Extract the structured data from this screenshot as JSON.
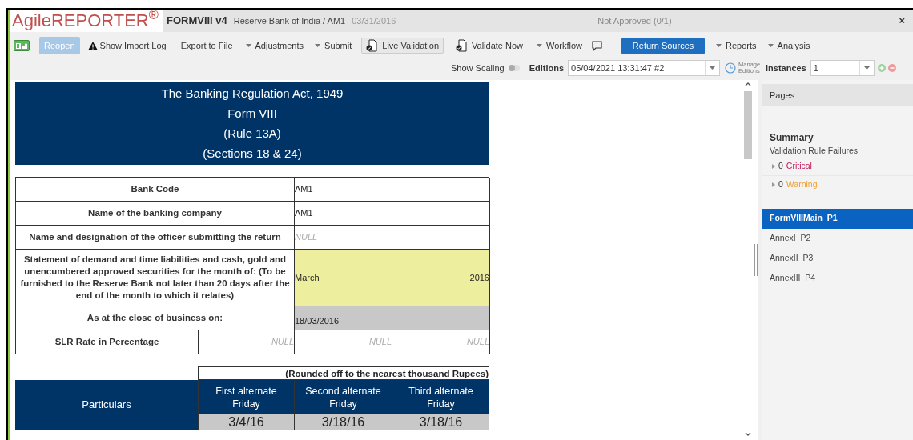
{
  "header": {
    "logo": "AgileREPORTER$^{®}$",
    "form": "FORMVIII v4",
    "entity": "Reserve Bank of India / AM1",
    "date": "03/31/2016",
    "status": "Not Approved (0/1)",
    "close": "×"
  },
  "toolbar": [
    {
      "kind": "lock"
    },
    {
      "kind": "button",
      "label": "Reopen",
      "disabled": true
    },
    {
      "kind": "warning",
      "label": "Show Import Log"
    },
    {
      "kind": "plain",
      "label": "Export to File"
    },
    {
      "kind": "menu",
      "label": "Adjustments"
    },
    {
      "kind": "menu",
      "label": "Submit"
    },
    {
      "kind": "toggle",
      "label": "Live Validation"
    },
    {
      "kind": "doc",
      "label": "Validate Now"
    },
    {
      "kind": "menu",
      "label": "Workflow"
    },
    {
      "kind": "comment"
    },
    {
      "kind": "primary",
      "label": "Return Sources"
    },
    {
      "kind": "menu",
      "label": "Reports"
    },
    {
      "kind": "menu",
      "label": "Analysis"
    }
  ],
  "options": {
    "show_scaling": {
      "label": "Show Scaling",
      "on": false
    },
    "editions": {
      "label": "Editions",
      "value": "05/04/2021 13:31:47 #2"
    },
    "manage_editions": "Manage Editions",
    "instances": {
      "label": "Instances",
      "value": "1"
    }
  },
  "form": {
    "title_lines": [
      "The Banking Regulation Act, 1949",
      "Form VIII",
      "(Rule 13A)",
      "(Sections 18 & 24)"
    ],
    "fields": [
      {
        "kind": "single",
        "label": "Bank Code",
        "values": [
          {
            "kind": "text",
            "text": "AM1"
          }
        ]
      },
      {
        "kind": "single",
        "label": "Name of the banking company",
        "values": [
          {
            "kind": "text",
            "text": "AM1"
          }
        ]
      },
      {
        "kind": "single",
        "label": "Name and designation of the officer submitting the return",
        "values": [
          {
            "kind": "null",
            "text": "NULL"
          }
        ]
      },
      {
        "kind": "pair",
        "label": "Statement of demand and time liabilities and cash, gold and unencumbered approved securities for the month of: (To be furnished to the Reserve Bank not later than 20 days after the end of the month to which it relates)",
        "values": [
          {
            "kind": "input",
            "text": "March"
          },
          {
            "kind": "input",
            "text": "2016"
          }
        ]
      },
      {
        "kind": "single",
        "label": "As at the close of business on:",
        "values": [
          {
            "kind": "locked",
            "text": "18/03/2016"
          }
        ]
      },
      {
        "kind": "triple",
        "label": "SLR Rate in Percentage",
        "values": [
          {
            "kind": "null",
            "text": "NULL"
          },
          {
            "kind": "null",
            "text": "NULL"
          },
          {
            "kind": "null",
            "text": "NULL"
          }
        ]
      }
    ],
    "amounts": {
      "note": "(Rounded off to the nearest thousand Rupees)",
      "particulars": "Particulars",
      "periods": [
        {
          "title": "First alternate Friday",
          "date": "3/4/16"
        },
        {
          "title": "Second alternate Friday",
          "date": "3/18/16"
        },
        {
          "title": "Third alternate Friday",
          "date": "3/18/16"
        }
      ]
    }
  },
  "panel": {
    "title": "Pages",
    "summary": "Summary",
    "subtitle": "Validation Rule Failures",
    "failures": [
      {
        "count": "0",
        "label": "Critical",
        "color": "#c0185a"
      },
      {
        "count": "0",
        "label": "Warning",
        "color": "#f0a030"
      }
    ],
    "pages": [
      {
        "label": "FormVIIIMain_P1",
        "selected": true
      },
      {
        "label": "AnnexI_P2",
        "selected": false
      },
      {
        "label": "AnnexII_P3",
        "selected": false
      },
      {
        "label": "AnnexIII_P4",
        "selected": false
      }
    ]
  }
}
